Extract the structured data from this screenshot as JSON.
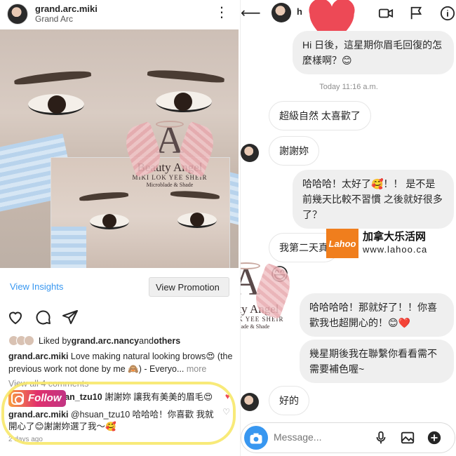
{
  "post": {
    "username": "grand.arc.miki",
    "location": "Grand Arc",
    "view_insights": "View Insights",
    "promote": "View Promotion",
    "liked_prefix": "Liked by ",
    "liked_user": "grand.arc.nancy",
    "liked_and": " and ",
    "liked_others": "others",
    "caption_user": "grand.arc.miki",
    "caption_text": " Love making natural looking brows😍 (the previous work not done by me 🙈) - Everyo...",
    "caption_more": " more",
    "view_all": "View all 4 comments",
    "comments": [
      {
        "user": "hsuan_tzu10",
        "text": " 謝謝妳 讓我有美美的眉毛😍"
      },
      {
        "user": "grand.arc.miki",
        "text": " @hsuan_tzu10 哈哈哈！你喜歡 我就開心了😊謝謝妳選了我～🥰"
      }
    ],
    "time_ago": "2 days ago",
    "follow_badge": "Follow"
  },
  "watermark": {
    "brand": "Beauty Angel",
    "artist": "MIKI LOK YEE SHEIR",
    "service": "Microblade & Shade",
    "letter": "A"
  },
  "dm": {
    "name": "h",
    "timestamp": "Today 11:16 a.m.",
    "messages": [
      {
        "from": "me",
        "text": "Hi 日後，這星期你眉毛回復的怎麼樣啊？😊"
      },
      {
        "from": "them",
        "text": "超級自然 太喜歡了"
      },
      {
        "from": "them",
        "text": "謝謝妳"
      },
      {
        "from": "me",
        "text": "哈哈哈！太好了🥰！！ 是不是前幾天比較不習慣 之後就好很多了？"
      },
      {
        "from": "them",
        "text": "我第二天真"
      },
      {
        "from": "me",
        "text": "哈哈哈哈！那就好了！！你喜歡我也超開心的！😊❤️"
      },
      {
        "from": "me",
        "text": "幾星期後我在聯繫你看看需不需要補色喔~"
      },
      {
        "from": "them",
        "text": "好的"
      }
    ],
    "emoji_reply": "😄",
    "input_placeholder": "Message..."
  },
  "overlay": {
    "site_logo": "Lahoo",
    "site_cn": "加拿大乐活网",
    "site_url": "www.lahoo.ca"
  },
  "colors": {
    "link_blue": "#3897f0",
    "heart_red": "#ed4956",
    "highlight_yellow": "#f7e86a"
  }
}
